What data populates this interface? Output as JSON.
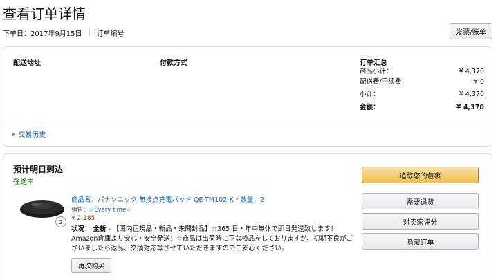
{
  "header": {
    "title": "查看订单详情",
    "order_date": "下单日：2017年9月15日",
    "order_number_label": "订单编号",
    "invoice_button": "发票/账单"
  },
  "details": {
    "shipping_address_label": "配送地址",
    "payment_method_label": "付款方式",
    "summary_title": "订单汇总",
    "summary_rows": [
      {
        "label": "商品小计：",
        "value": "¥ 4,370"
      },
      {
        "label": "配送费/手续费：",
        "value": "¥ 0"
      },
      {
        "label": "小计：",
        "value": "¥ 4,370"
      },
      {
        "label": "金额：",
        "value": "¥ 4,370"
      }
    ],
    "history_link": "交易历史"
  },
  "shipment": {
    "title": "预计明日到达",
    "status": "在途中",
    "status_color": "#007600",
    "product": {
      "name": "商品名：パナソニック 無接点充電パッド QE-TM102-K・数量：2",
      "quantity": "2",
      "seller_prefix": "销售：",
      "seller_name": "☆Every time☆",
      "price": "¥ 2,185",
      "condition_label": "状况：",
      "condition_value": "全新",
      "condition_text": " - 【国内正規品・新品・未開封品】☆365 日・年中無休で即日発送致します！Amazon倉庫より安心・安全発送！☆商品は出荷時に正な検品をしておりますが、初期不良がございましたら返品、交換対応等させていただきますのでご安心ください。"
    },
    "rebuy_button": "再次购买",
    "actions": [
      "追踪您的包裹",
      "需要退货",
      "对卖家评分",
      "隐藏订单"
    ]
  },
  "colors": {
    "link": "#0066c0",
    "price": "#b12704",
    "primary_button": "#f0c14b"
  }
}
